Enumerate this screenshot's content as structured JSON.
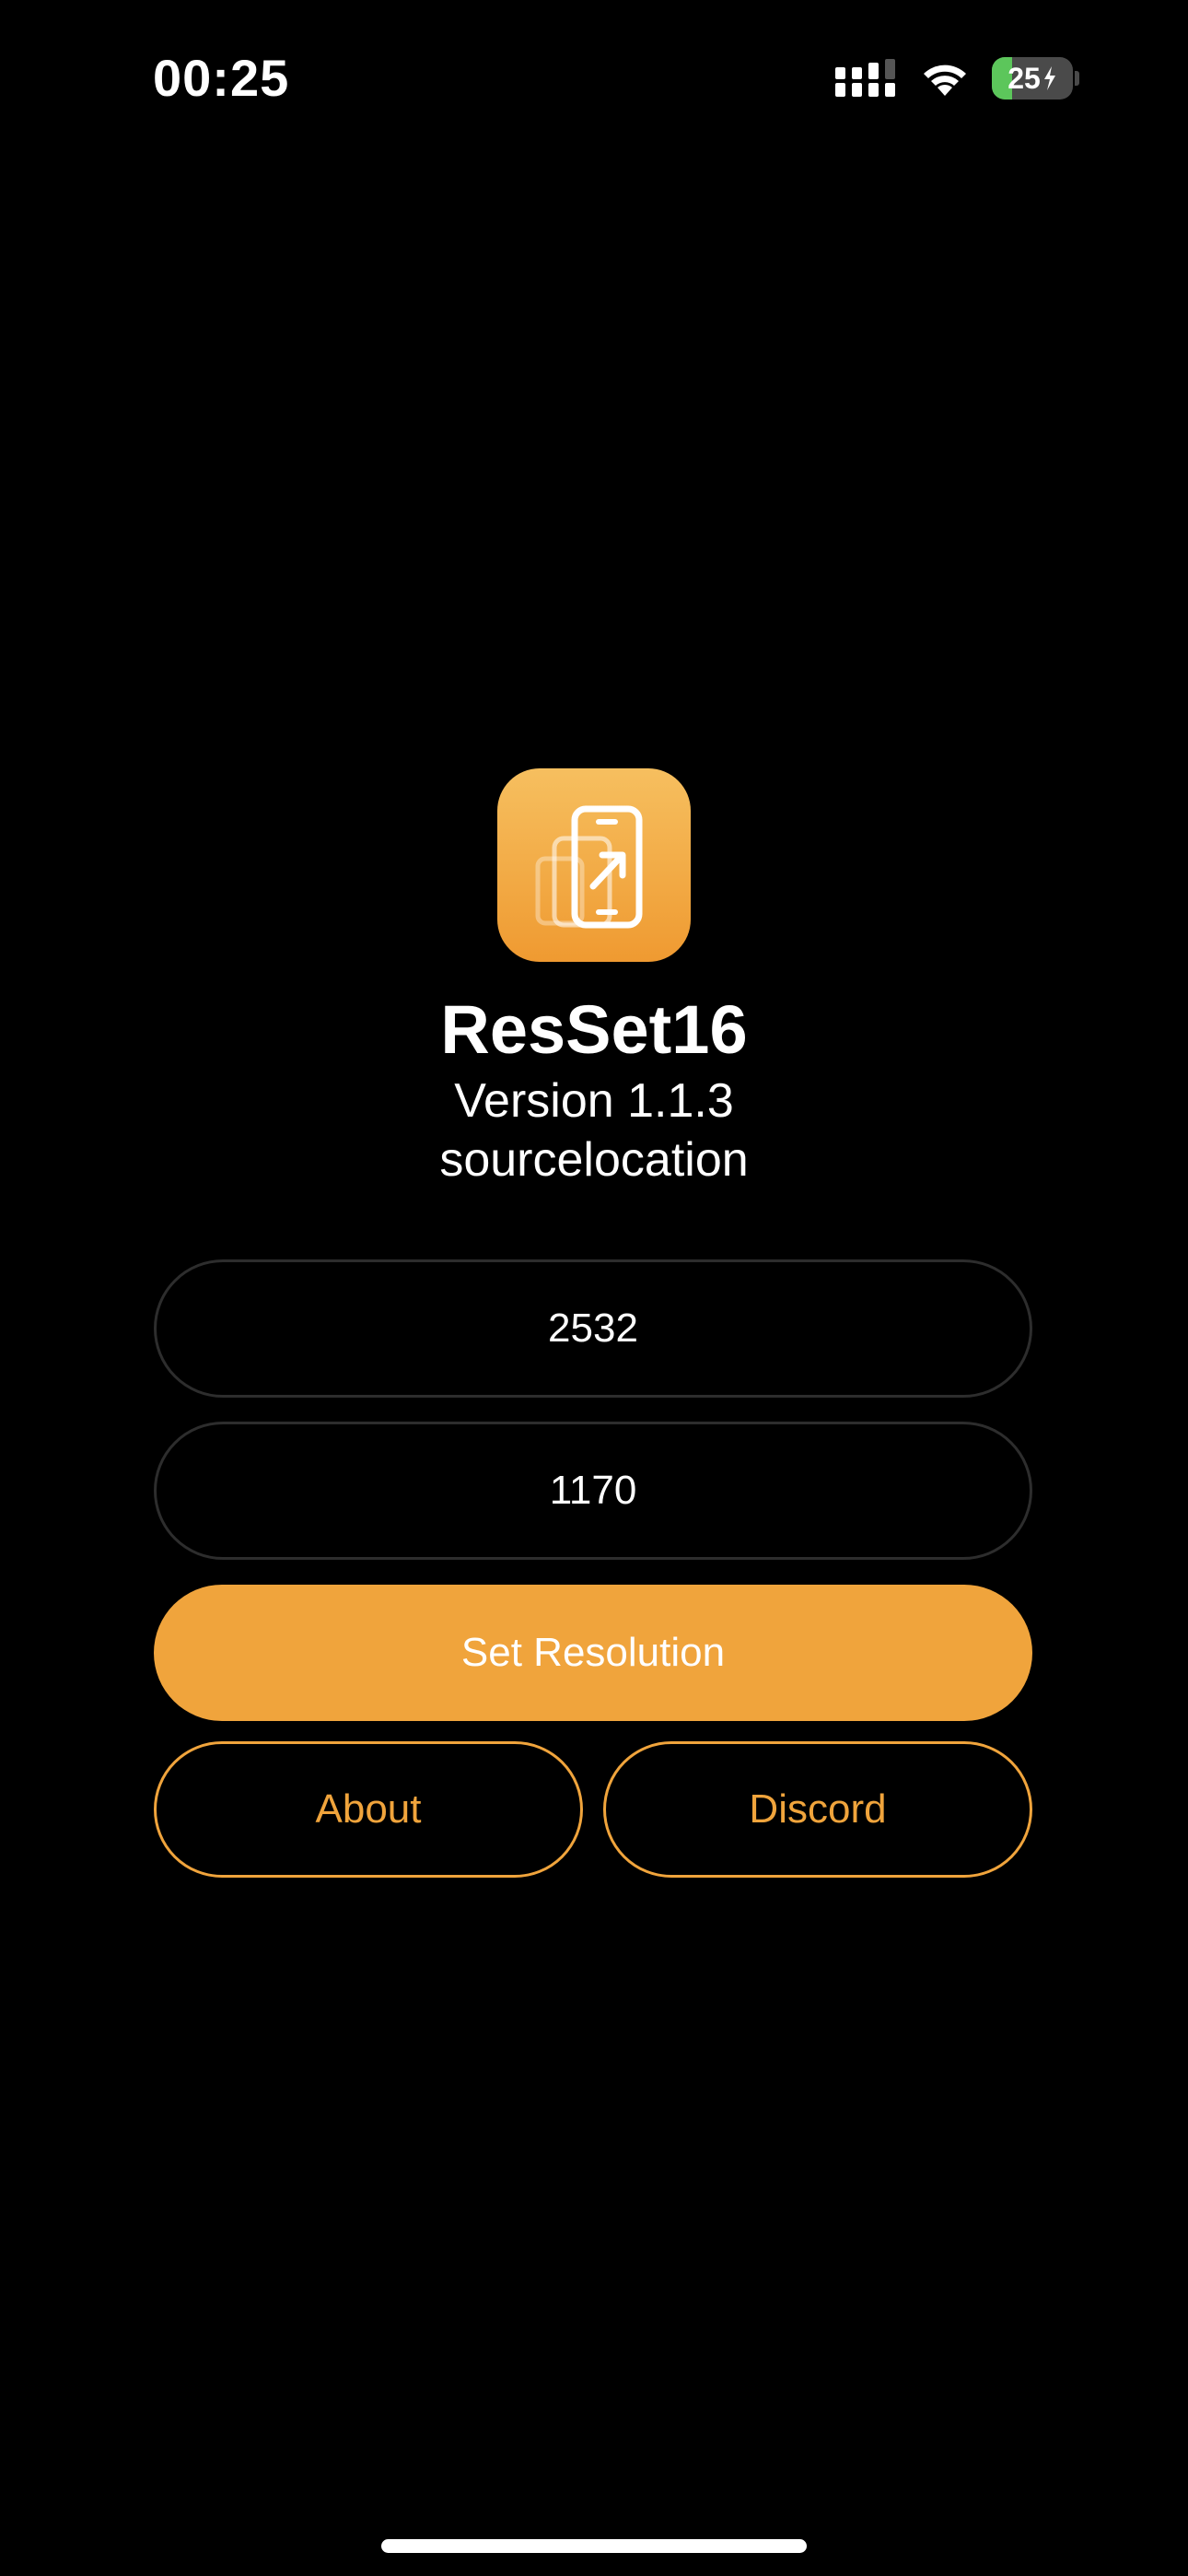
{
  "status_bar": {
    "time": "00:25",
    "battery": {
      "label": "25",
      "level": 0.25
    }
  },
  "app": {
    "name": "ResSet16",
    "version": "Version 1.1.3",
    "author": "sourcelocation",
    "icon": "phone-resize-icon"
  },
  "form": {
    "height_value": "2532",
    "width_value": "1170"
  },
  "buttons": {
    "set_resolution": "Set Resolution",
    "about": "About",
    "discord": "Discord"
  },
  "colors": {
    "accent": "#f0a43c",
    "background": "#000000",
    "field_border": "#2d2d2d"
  }
}
